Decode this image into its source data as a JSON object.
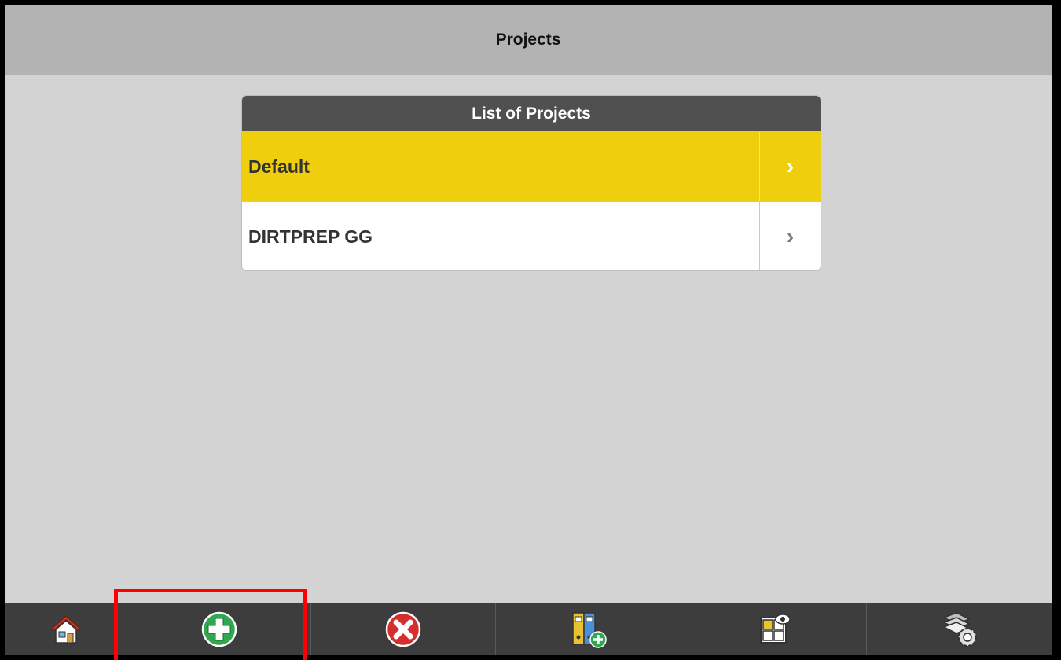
{
  "header": {
    "title": "Projects"
  },
  "project_list": {
    "heading": "List of Projects",
    "items": [
      {
        "label": "Default",
        "selected": true
      },
      {
        "label": "DIRTPREP GG",
        "selected": false
      }
    ],
    "chevron": "›"
  },
  "toolbar": {
    "buttons": [
      {
        "name": "home",
        "icon": "home-icon"
      },
      {
        "name": "add",
        "icon": "add-icon"
      },
      {
        "name": "delete",
        "icon": "delete-icon"
      },
      {
        "name": "add-binder",
        "icon": "binder-add-icon"
      },
      {
        "name": "view-layout",
        "icon": "layout-view-icon"
      },
      {
        "name": "layer-settings",
        "icon": "layers-gear-icon"
      }
    ]
  },
  "colors": {
    "selected_row": "#efce0e",
    "header_bar": "#b3b3b3",
    "panel_header": "#505050",
    "toolbar": "#3d3d3d",
    "highlight": "#ff0000"
  }
}
